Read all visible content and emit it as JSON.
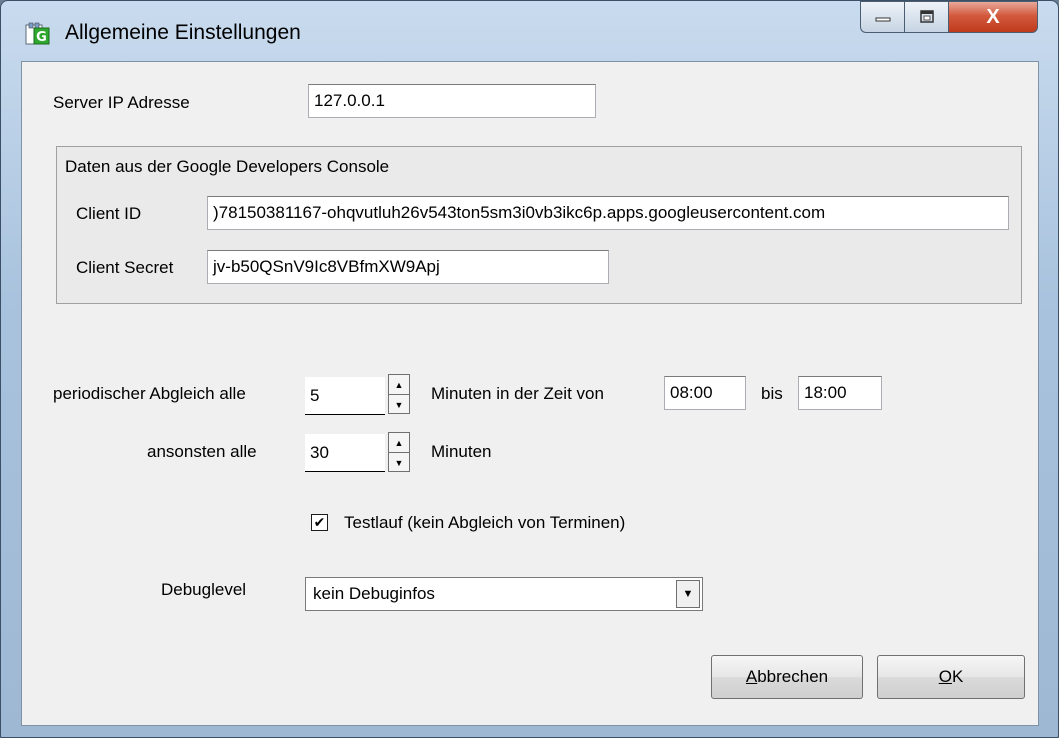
{
  "window": {
    "title": "Allgemeine Einstellungen",
    "close_glyph": "X"
  },
  "server": {
    "label": "Server IP Adresse",
    "value": "127.0.0.1"
  },
  "google": {
    "group_label": "Daten aus der Google Developers Console",
    "client_id_label": "Client ID",
    "client_id_value": ")78150381167-ohqvutluh26v543ton5sm3i0vb3ikc6p.apps.googleusercontent.com",
    "client_secret_label": "Client Secret",
    "client_secret_value": "jv-b50QSnV9Ic8VBfmXW9Apj"
  },
  "sync": {
    "periodic_label": "periodischer Abgleich alle",
    "periodic_value": "5",
    "minutes_in_time_label": "Minuten in der Zeit von",
    "from_value": "08:00",
    "bis_label": "bis",
    "to_value": "18:00",
    "otherwise_label": "ansonsten alle",
    "otherwise_value": "30",
    "minutes_label": "Minuten"
  },
  "testrun": {
    "checked": true,
    "label": "Testlauf (kein Abgleich von Terminen)"
  },
  "debug": {
    "label": "Debuglevel",
    "selected": "kein Debuginfos"
  },
  "buttons": {
    "cancel_hotkey": "A",
    "cancel_rest": "bbrechen",
    "ok_hotkey": "O",
    "ok_rest": "K"
  },
  "icons": {
    "app": "app-icon",
    "minimize": "minimize-icon",
    "maximize": "maximize-icon",
    "close": "close-icon",
    "spin_up": "arrow-up-icon",
    "spin_down": "arrow-down-icon",
    "dropdown": "chevron-down-icon",
    "check": "checkmark-icon"
  },
  "colors": {
    "titlebar": "#a9c3de",
    "close_button": "#c03a1c",
    "dialog_bg": "#f0f0f0"
  }
}
